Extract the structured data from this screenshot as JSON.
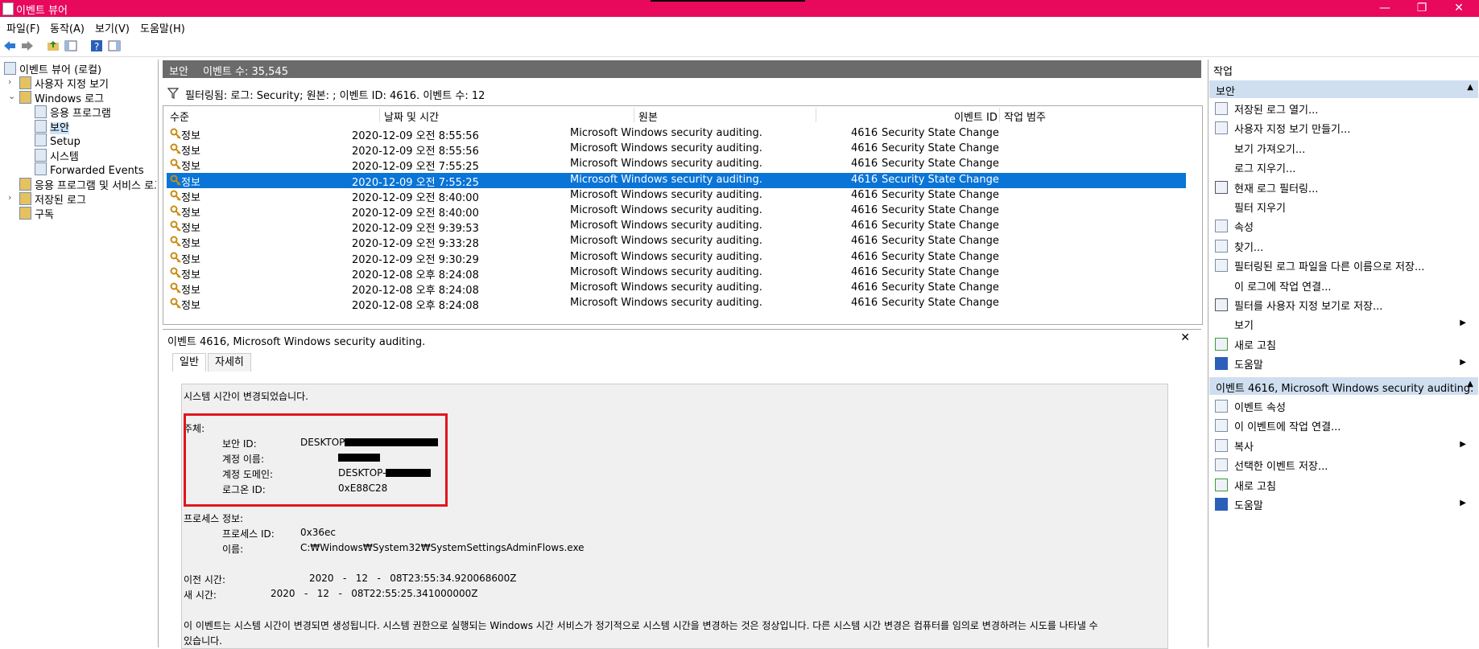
{
  "window": {
    "title": "이벤트 뷰어",
    "minimize": "—",
    "maximize": "❐",
    "close": "✕"
  },
  "menu": [
    "파일(F)",
    "동작(A)",
    "보기(V)",
    "도움말(H)"
  ],
  "tree": {
    "root": "이벤트 뷰어 (로컬)",
    "custom_views": "사용자 지정 보기",
    "windows_logs": "Windows 로그",
    "app": "응용 프로그램",
    "security": "보안",
    "setup": "Setup",
    "system": "시스템",
    "forwarded": "Forwarded Events",
    "app_services": "응용 프로그램 및 서비스 로그",
    "saved_logs": "저장된 로그",
    "subscriptions": "구독"
  },
  "midhead": {
    "log_name": "보안",
    "event_count": "이벤트 수: 35,545"
  },
  "filter": "필터링됨: 로그: Security; 원본: ; 이벤트 ID: 4616. 이벤트 수: 12",
  "table": {
    "headers": [
      "수준",
      "날짜 및 시간",
      "원본",
      "이벤트 ID",
      "작업 범주"
    ],
    "rows": [
      {
        "level": "정보",
        "datetime": "2020-12-09 오전 8:55:56",
        "source": "Microsoft Windows security auditing.",
        "id": "4616",
        "category": "Security State Change"
      },
      {
        "level": "정보",
        "datetime": "2020-12-09 오전 8:55:56",
        "source": "Microsoft Windows security auditing.",
        "id": "4616",
        "category": "Security State Change"
      },
      {
        "level": "정보",
        "datetime": "2020-12-09 오전 7:55:25",
        "source": "Microsoft Windows security auditing.",
        "id": "4616",
        "category": "Security State Change"
      },
      {
        "level": "정보",
        "datetime": "2020-12-09 오전 7:55:25",
        "source": "Microsoft Windows security auditing.",
        "id": "4616",
        "category": "Security State Change"
      },
      {
        "level": "정보",
        "datetime": "2020-12-09 오전 8:40:00",
        "source": "Microsoft Windows security auditing.",
        "id": "4616",
        "category": "Security State Change"
      },
      {
        "level": "정보",
        "datetime": "2020-12-09 오전 8:40:00",
        "source": "Microsoft Windows security auditing.",
        "id": "4616",
        "category": "Security State Change"
      },
      {
        "level": "정보",
        "datetime": "2020-12-09 오전 9:39:53",
        "source": "Microsoft Windows security auditing.",
        "id": "4616",
        "category": "Security State Change"
      },
      {
        "level": "정보",
        "datetime": "2020-12-09 오전 9:33:28",
        "source": "Microsoft Windows security auditing.",
        "id": "4616",
        "category": "Security State Change"
      },
      {
        "level": "정보",
        "datetime": "2020-12-09 오전 9:30:29",
        "source": "Microsoft Windows security auditing.",
        "id": "4616",
        "category": "Security State Change"
      },
      {
        "level": "정보",
        "datetime": "2020-12-08 오후 8:24:08",
        "source": "Microsoft Windows security auditing.",
        "id": "4616",
        "category": "Security State Change"
      },
      {
        "level": "정보",
        "datetime": "2020-12-08 오후 8:24:08",
        "source": "Microsoft Windows security auditing.",
        "id": "4616",
        "category": "Security State Change"
      },
      {
        "level": "정보",
        "datetime": "2020-12-08 오후 8:24:08",
        "source": "Microsoft Windows security auditing.",
        "id": "4616",
        "category": "Security State Change"
      }
    ]
  },
  "detail": {
    "header": "이벤트 4616, Microsoft Windows security auditing.",
    "close": "✕",
    "tab_general": "일반",
    "tab_details": "자세히",
    "summary": "시스템 시간이 변경되었습니다.",
    "subject": "주체:",
    "sec_id_label": "보안 ID:",
    "sec_id_value": "DESKTOP",
    "account_name_label": "계정 이름:",
    "account_domain_label": "계정 도메인:",
    "account_domain_value": "DESKTOP-",
    "logon_id_label": "로그온 ID:",
    "logon_id_value": "0xE88C28",
    "process_info": "프로세스 정보:",
    "process_id_label": "프로세스 ID:",
    "process_id_value": "0x36ec",
    "name_label": "이름:",
    "name_value": "C:₩Windows₩System32₩SystemSettingsAdminFlows.exe",
    "prev_time_label": "이전 시간:",
    "prev_time_value": "2020   -   12   -   08T23:55:34.920068600Z",
    "new_time_label": "새 시간:",
    "new_time_value": "2020   -   12   -   08T22:55:25.341000000Z",
    "desc1": "이 이벤트는 시스템 시간이 변경되면 생성됩니다. 시스템 권한으로 실행되는 Windows 시간 서비스가 정기적으로 시스템 시간을 변경하는 것은 정상입니다. 다른 시스템 시간 변경은 컴퓨터를 임의로 변경하려는 시도를 나타낼 수",
    "desc2": "있습니다."
  },
  "actions": {
    "title": "작업",
    "section1": "보안",
    "items1": [
      "저장된 로그 열기...",
      "사용자 지정 보기 만들기...",
      "보기 가져오기...",
      "로그 지우기...",
      "현재 로그 필터링...",
      "필터 지우기",
      "속성",
      "찾기...",
      "필터링된 로그 파일을 다른 이름으로 저장...",
      "이 로그에 작업 연결...",
      "필터를 사용자 지정 보기로 저장...",
      "보기",
      "새로 고침",
      "도움말"
    ],
    "section2": "이벤트 4616, Microsoft Windows security auditing.",
    "items2": [
      "이벤트 속성",
      "이 이벤트에 작업 연결...",
      "복사",
      "선택한 이벤트 저장...",
      "새로 고침",
      "도움말"
    ]
  }
}
